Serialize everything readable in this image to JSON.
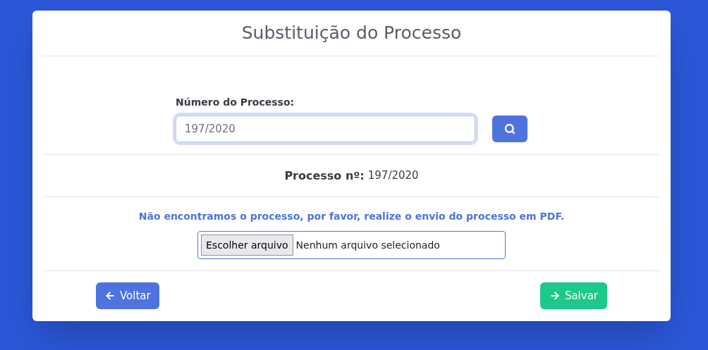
{
  "title": "Substituição do Processo",
  "search": {
    "label": "Número do Processo:",
    "value": "197/2020",
    "focused": true
  },
  "process": {
    "label": "Processo nº:",
    "value": "197/2020"
  },
  "message": "Não encontramos o processo, por favor, realize o envio do processo em PDF.",
  "file_input": {
    "button": "Escolher arquivo",
    "status": "Nenhum arquivo selecionado"
  },
  "actions": [
    {
      "kind": "back",
      "label": "Voltar"
    },
    {
      "kind": "save",
      "label": "Salvar"
    }
  ]
}
